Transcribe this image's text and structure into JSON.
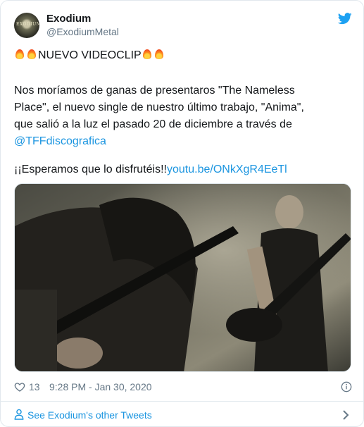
{
  "tweet": {
    "author_name": "Exodium",
    "author_handle": "@ExodiumMetal",
    "avatar_text": "EXODIUM",
    "headline": "NUEVO VIDEOCLIP",
    "body_lines": [
      "Nos moríamos de ganas de presentaros \"The Nameless",
      "Place\", el nuevo single de nuestro último trabajo, \"Anima\",",
      "que salió a la luz el pasado 20 de diciembre a través de"
    ],
    "mention": "@TFFdiscografica",
    "closing_text": "¡¡Esperamos que lo disfrutéis!!",
    "link_text": "youtu.be/ONkXgR4EeTl",
    "likes": "13",
    "timestamp": "9:28 PM - Jan 30, 2020"
  },
  "footer": {
    "more_tweets_label": "See Exodium's other Tweets"
  },
  "icons": {
    "brand": "twitter-bird-icon",
    "like": "heart-icon",
    "info": "info-icon",
    "user": "user-icon",
    "chevron": "chevron-right-icon"
  },
  "colors": {
    "link": "#1b95e0",
    "text": "#14171a",
    "muted": "#657786",
    "border": "#e1e8ed"
  }
}
